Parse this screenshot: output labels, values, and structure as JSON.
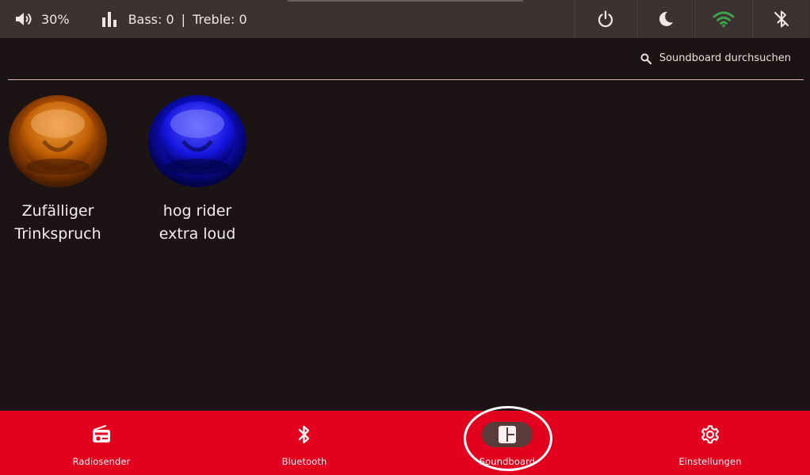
{
  "status": {
    "volume": "30%",
    "bass_label": "Bass: 0",
    "separator": "|",
    "treble_label": "Treble: 0",
    "icons": [
      "volume-icon",
      "equalizer-icon",
      "power-icon",
      "moon-icon",
      "wifi-icon",
      "bluetooth-off-icon"
    ],
    "wifi_color": "#3fa34d"
  },
  "search": {
    "label": "Soundboard durchsuchen"
  },
  "sounds": [
    {
      "label_line1": "Zufälliger",
      "label_line2": "Trinkspruch",
      "color": "#c85a00"
    },
    {
      "label_line1": "hog rider",
      "label_line2": "extra loud",
      "color": "#1717e6"
    }
  ],
  "nav": {
    "items": [
      {
        "label": "Radiosender",
        "icon": "radio-icon"
      },
      {
        "label": "Bluetooth",
        "icon": "bluetooth-icon"
      },
      {
        "label": "Soundboard",
        "icon": "soundboard-icon",
        "active": true
      },
      {
        "label": "Einstellungen",
        "icon": "settings-icon"
      }
    ],
    "background": "#e2001e"
  }
}
